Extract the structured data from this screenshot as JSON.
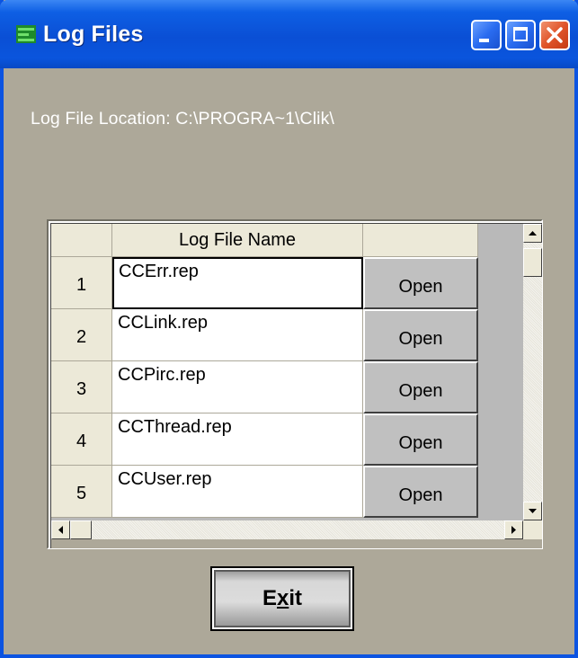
{
  "window": {
    "title": "Log Files",
    "controls": {
      "minimize": "minimize-icon",
      "maximize": "maximize-icon",
      "close": "close-icon"
    }
  },
  "location": {
    "text": "Log File Location: C:\\PROGRA~1\\Clik\\"
  },
  "grid": {
    "header": {
      "name": "Log File Name"
    },
    "rows": [
      {
        "num": "1",
        "name": "CCErr.rep",
        "action": "Open"
      },
      {
        "num": "2",
        "name": "CCLink.rep",
        "action": "Open"
      },
      {
        "num": "3",
        "name": "CCPirc.rep",
        "action": "Open"
      },
      {
        "num": "4",
        "name": "CCThread.rep",
        "action": "Open"
      },
      {
        "num": "5",
        "name": "CCUser.rep",
        "action": "Open"
      }
    ]
  },
  "exit": {
    "label_pre": "E",
    "label_u": "x",
    "label_post": "it"
  },
  "colors": {
    "window_bg": "#ada899",
    "titlebar": "#0a4fd5",
    "header_bg": "#ece9d8"
  }
}
